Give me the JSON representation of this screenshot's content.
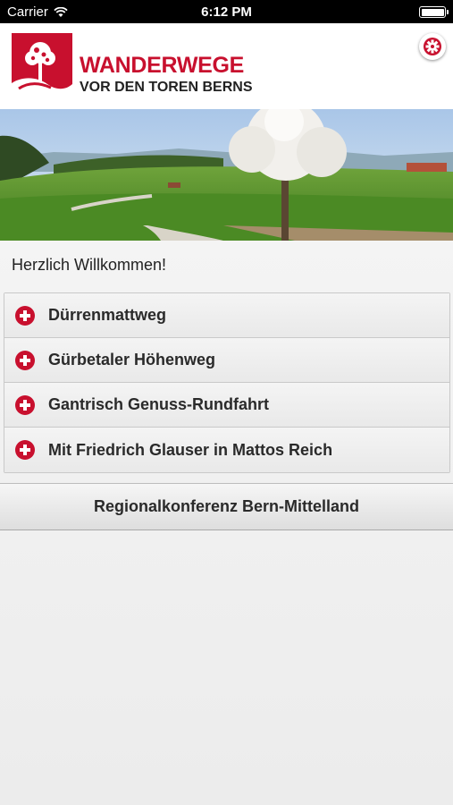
{
  "status_bar": {
    "carrier": "Carrier",
    "time": "6:12 PM",
    "battery_level": 1.0
  },
  "header": {
    "logo_title": "WANDERWEGE",
    "logo_subtitle": "VOR DEN TOREN BERNS",
    "brand_color": "#c8102e",
    "settings_icon": "gear-icon"
  },
  "welcome_text": "Herzlich Willkommen!",
  "routes": [
    {
      "label": "Dürrenmattweg",
      "icon": "plus-icon"
    },
    {
      "label": "Gürbetaler Höhenweg",
      "icon": "plus-icon"
    },
    {
      "label": "Gantrisch Genuss-Rundfahrt",
      "icon": "plus-icon"
    },
    {
      "label": "Mit Friedrich Glauser in Mattos Reich",
      "icon": "plus-icon"
    }
  ],
  "region_button": "Regionalkonferenz Bern-Mittelland"
}
